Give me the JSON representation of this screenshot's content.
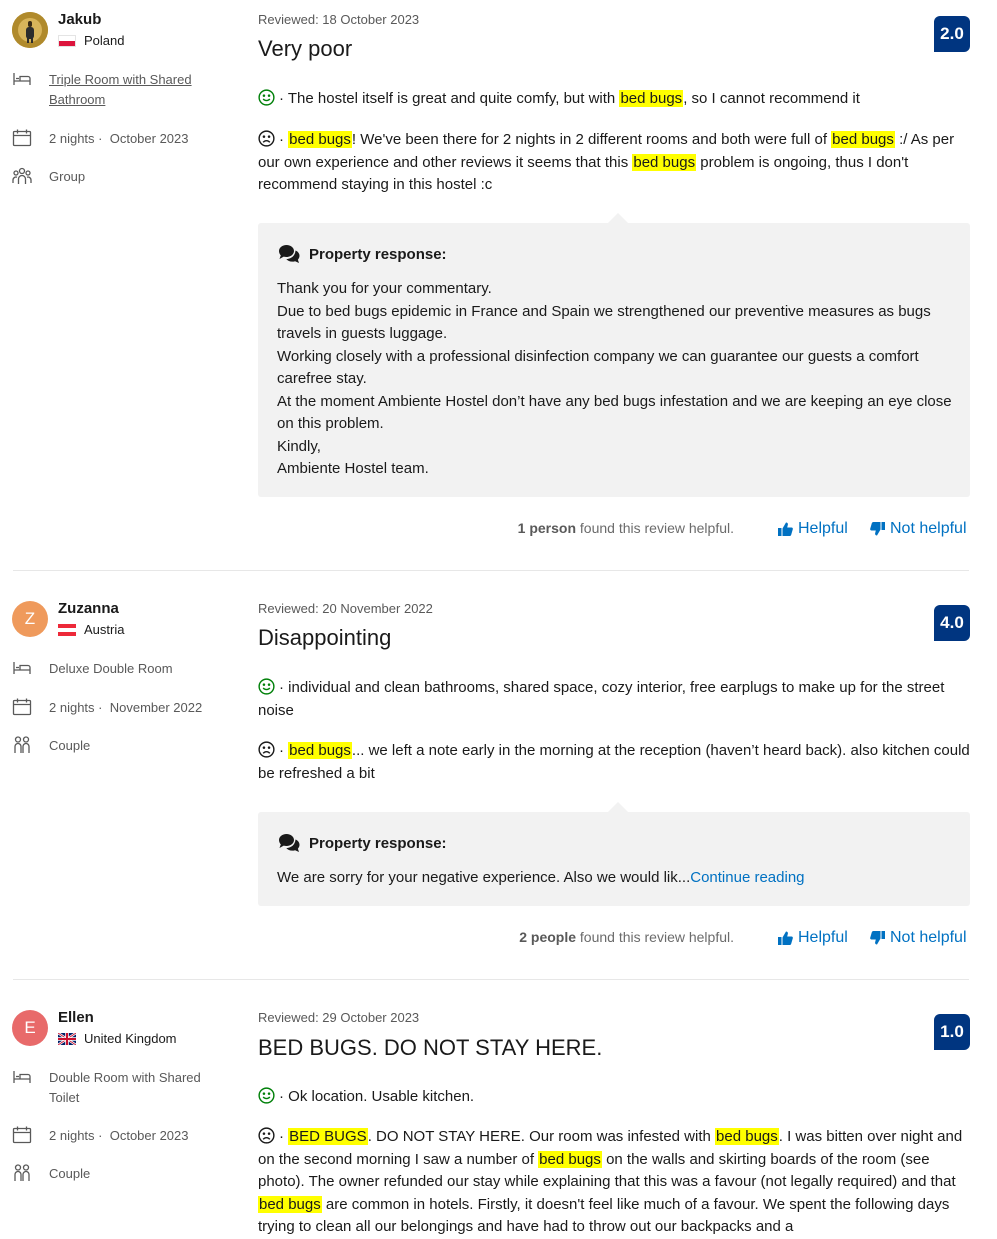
{
  "colors": {
    "score_bg": "#003580",
    "link": "#0071c2",
    "highlight": "#ffff00",
    "positive_face": "#008009",
    "response_bg": "#f2f2f2"
  },
  "reviews": [
    {
      "avatar_letter": "",
      "avatar_color": "#b8922e",
      "name": "Jakub",
      "country": "Poland",
      "room": "Triple Room with Shared Bathroom",
      "stay_nights": "2 nights ·",
      "stay_month": "October 2023",
      "traveler_type": "Group",
      "date": "Reviewed: 18 October 2023",
      "title": "Very poor",
      "score": "2.0",
      "positive": {
        "prefix": "· The hostel itself is great and quite comfy, but with ",
        "mark": "bed bugs",
        "suffix": ", so I cannot recommend it"
      },
      "negative": {
        "prefix": "· ",
        "mark1": "bed bugs",
        "mid1": "! We've been there for 2 nights in 2 different rooms and both were full of ",
        "mark2": "bed bugs",
        "mid2": " :/ As per our own experience and other reviews it seems that this ",
        "mark3": "bed bugs",
        "suffix": " problem is ongoing, thus I don't recommend staying in this hostel :c"
      },
      "response_label": "Property response:",
      "response_lines": [
        "Thank you for your commentary.",
        "Due to bed bugs epidemic in France and Spain we strengthened our preventive measures as bugs travels in guests luggage.",
        "Working closely with a professional disinfection company we can guarantee our guests a comfort carefree stay.",
        "At the moment Ambiente Hostel don’t have any bed bugs infestation and we are keeping an eye close on this problem.",
        "Kindly,",
        "Ambiente Hostel team."
      ],
      "helpful_count": "1 person",
      "helpful_suffix": " found this review helpful.",
      "helpful_label": "Helpful",
      "not_helpful_label": "Not helpful"
    },
    {
      "avatar_letter": "Z",
      "avatar_color": "#ef9a5c",
      "name": "Zuzanna",
      "country": "Austria",
      "room": "Deluxe Double Room",
      "stay_nights": "2 nights ·",
      "stay_month": "November 2022",
      "traveler_type": "Couple",
      "date": "Reviewed: 20 November 2022",
      "title": "Disappointing",
      "score": "4.0",
      "positive": {
        "text": "· individual and clean bathrooms, shared space, cozy interior, free earplugs to make up for the street noise"
      },
      "negative": {
        "prefix": "· ",
        "mark1": "bed bugs",
        "suffix": "... we left a note early in the morning at the reception (haven’t heard back). also kitchen could be refreshed a bit"
      },
      "response_label": "Property response:",
      "response_text": "We are sorry for your negative experience. Also we would lik...",
      "continue_reading": "Continue reading",
      "helpful_count": "2 people",
      "helpful_suffix": " found this review helpful.",
      "helpful_label": "Helpful",
      "not_helpful_label": "Not helpful"
    },
    {
      "avatar_letter": "E",
      "avatar_color": "#e86a6a",
      "name": "Ellen",
      "country": "United Kingdom",
      "room": "Double Room with Shared Toilet",
      "stay_nights": "2 nights ·",
      "stay_month": "October 2023",
      "traveler_type": "Couple",
      "date": "Reviewed: 29 October 2023",
      "title": "BED BUGS. DO NOT STAY HERE.",
      "score": "1.0",
      "positive": {
        "text": "· Ok location. Usable kitchen."
      },
      "negative": {
        "prefix": "· ",
        "mark1": "BED BUGS",
        "mid1": ". DO NOT STAY HERE. Our room was infested with ",
        "mark2": "bed bugs",
        "mid2": ". I was bitten over night and on the second morning I saw a number of ",
        "mark3": "bed bugs",
        "mid3": " on the walls and skirting boards of the room (see photo). The owner refunded our stay while explaining that this was a favour (not legally required) and that ",
        "mark4": "bed bugs",
        "suffix": " are common in hotels. Firstly, it doesn't feel like much of a favour. We spent the following days trying to clean all our belongings and have had to throw out our backpacks and a"
      }
    }
  ]
}
